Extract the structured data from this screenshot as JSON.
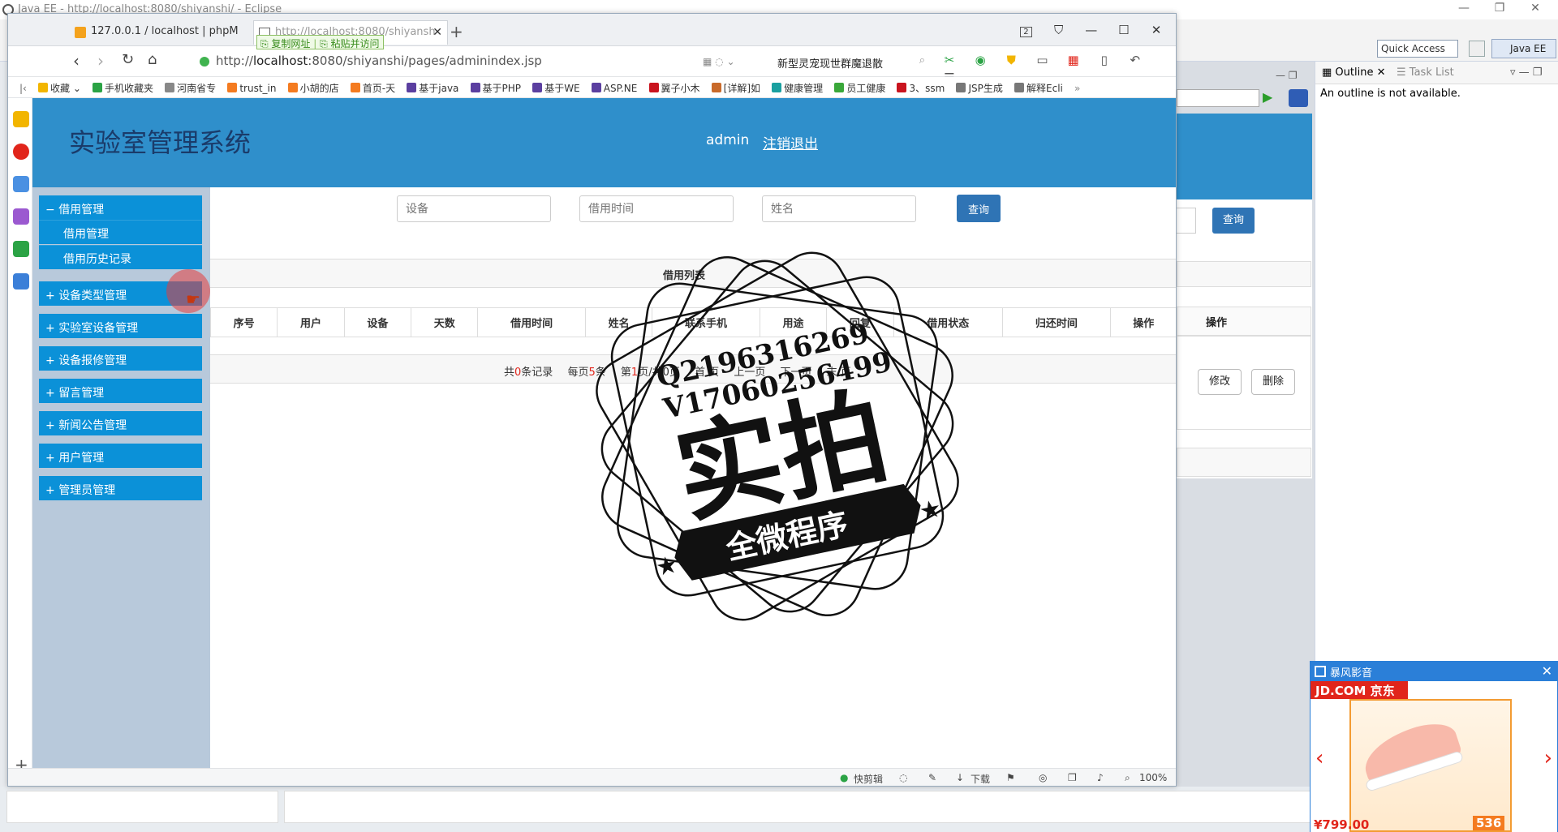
{
  "eclipse": {
    "title": "Java EE - http://localhost:8080/shiyanshi/ - Eclipse",
    "quick_access": "Quick Access",
    "perspective": "Java EE",
    "outline_tab": "Outline",
    "task_tab": "Task List",
    "outline_message": "An outline is not available.",
    "behind_query": "查询",
    "behind_operation": "操作",
    "behind_edit": "修改",
    "behind_delete": "删除"
  },
  "browser": {
    "tabs": [
      {
        "label": "127.0.0.1 / localhost | phpMyA"
      },
      {
        "label": "http://localhost:8080/shiyansh"
      }
    ],
    "copy_url": "复制网址",
    "paste_visit": "粘贴并访问",
    "tab_count": "2",
    "url_scheme": "http://",
    "url_host": "localhost",
    "url_rest": ":8080/shiyanshi/pages/adminindex.jsp",
    "search_text": "新型灵宠现世群魔退散",
    "bookmarks": [
      "收藏",
      "手机收藏夹",
      "河南省专",
      "trust_in",
      "小胡的店",
      "首页-天",
      "基于java",
      "基于PHP",
      "基于WE",
      "ASP.NE",
      "翼子小木",
      "[详解]如",
      "健康管理",
      "员工健康",
      "3、ssm",
      "JSP生成",
      "解释Ecli"
    ],
    "bookmark_colors": [
      "#f2b500",
      "#2ba345",
      "#888888",
      "#f47b20",
      "#f47b20",
      "#f47b20",
      "#5b3fa0",
      "#5b3fa0",
      "#5b3fa0",
      "#5b3fa0",
      "#c9141e",
      "#c96a2a",
      "#1aa0a0",
      "#3aa83a",
      "#c9141e",
      "#777777",
      "#777777"
    ],
    "status": {
      "clip": "快剪辑",
      "download": "下载",
      "zoom": "100%"
    }
  },
  "app": {
    "title": "实验室管理系统",
    "user": "admin",
    "logout": "注销退出",
    "menu": [
      {
        "label": "借用管理",
        "prefix": "−",
        "subs": [
          "借用管理",
          "借用历史记录"
        ]
      },
      {
        "label": "设备类型管理",
        "prefix": "+"
      },
      {
        "label": "实验室设备管理",
        "prefix": "+"
      },
      {
        "label": "设备报修管理",
        "prefix": "+"
      },
      {
        "label": "留言管理",
        "prefix": "+"
      },
      {
        "label": "新闻公告管理",
        "prefix": "+"
      },
      {
        "label": "用户管理",
        "prefix": "+"
      },
      {
        "label": "管理员管理",
        "prefix": "+"
      }
    ],
    "search": {
      "device_placeholder": "设备",
      "time_placeholder": "借用时间",
      "name_placeholder": "姓名",
      "query": "查询"
    },
    "list_title": "借用列表",
    "columns": [
      "序号",
      "用户",
      "设备",
      "天数",
      "借用时间",
      "姓名",
      "联系手机",
      "用途",
      "回复",
      "借用状态",
      "归还时间",
      "操作"
    ],
    "pager": {
      "total_pre": "共",
      "total": "0",
      "total_post": "条记录",
      "per_pre": "每页",
      "per": "5",
      "per_post": "条",
      "page_pre": "第",
      "page": "1",
      "page_mid": "页/共",
      "pages": "0",
      "page_post": "页",
      "first": "首 页",
      "prev": "上一页",
      "next": "下一页",
      "last": "末 页"
    }
  },
  "watermark": {
    "q": "Q2196316269",
    "v": "V17060256499",
    "big": "实拍",
    "ribbon": "全微程序"
  },
  "ad": {
    "title": "暴风影音",
    "brand": "JD.COM 京东",
    "price": "¥799.00",
    "price2": "536"
  }
}
